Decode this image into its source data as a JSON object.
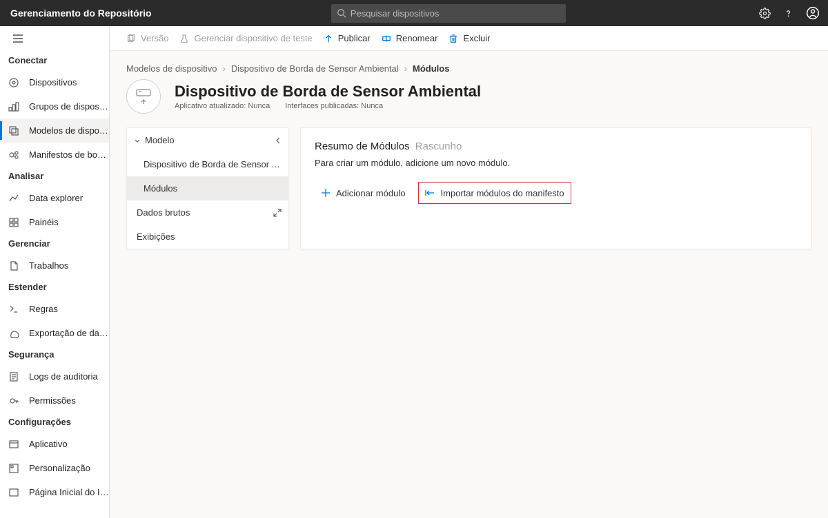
{
  "header": {
    "app_title": "Gerenciamento do Repositório",
    "search_placeholder": "Pesquisar dispositivos"
  },
  "sidebar": {
    "sections": [
      {
        "title": "Conectar",
        "items": [
          {
            "label": "Dispositivos",
            "icon": "device"
          },
          {
            "label": "Grupos de dispositivos",
            "icon": "groups"
          },
          {
            "label": "Modelos de disposit...",
            "icon": "template",
            "active": true
          },
          {
            "label": "Manifestos de borda",
            "icon": "manifest"
          }
        ]
      },
      {
        "title": "Analisar",
        "items": [
          {
            "label": "Data explorer",
            "icon": "analytics"
          },
          {
            "label": "Painéis",
            "icon": "dashboard"
          }
        ]
      },
      {
        "title": "Gerenciar",
        "items": [
          {
            "label": "Trabalhos",
            "icon": "jobs"
          }
        ]
      },
      {
        "title": "Estender",
        "items": [
          {
            "label": "Regras",
            "icon": "rules"
          },
          {
            "label": "Exportação de dados",
            "icon": "export"
          }
        ]
      },
      {
        "title": "Segurança",
        "items": [
          {
            "label": "Logs de auditoria",
            "icon": "audit"
          },
          {
            "label": "Permissões",
            "icon": "permissions"
          }
        ]
      },
      {
        "title": "Configurações",
        "items": [
          {
            "label": "Aplicativo",
            "icon": "app"
          },
          {
            "label": "Personalização",
            "icon": "customize"
          },
          {
            "label": "Página Inicial do IoT C...",
            "icon": "home"
          }
        ]
      }
    ]
  },
  "toolbar": {
    "version": "Versão",
    "manage_test": "Gerenciar dispositivo de teste",
    "publish": "Publicar",
    "rename": "Renomear",
    "delete": "Excluir"
  },
  "breadcrumb": {
    "a": "Modelos de dispositivo",
    "b": "Dispositivo de Borda de Sensor Ambiental",
    "c": "Módulos"
  },
  "page": {
    "title": "Dispositivo de Borda de Sensor Ambiental",
    "meta_app": "Aplicativo atualizado: Nunca",
    "meta_if": "Interfaces publicadas: Nunca"
  },
  "model_panel": {
    "header": "Modelo",
    "items": [
      {
        "label": "Dispositivo de Borda de Sensor Am..."
      },
      {
        "label": "Módulos",
        "selected": true
      },
      {
        "label": "Dados brutos",
        "expand": true
      },
      {
        "label": "Exibições"
      }
    ]
  },
  "summary": {
    "title": "Resumo de Módulos",
    "draft": "Rascunho",
    "hint": "Para criar um módulo, adicione um novo módulo.",
    "add": "Adicionar módulo",
    "import": "Importar módulos do manifesto"
  }
}
